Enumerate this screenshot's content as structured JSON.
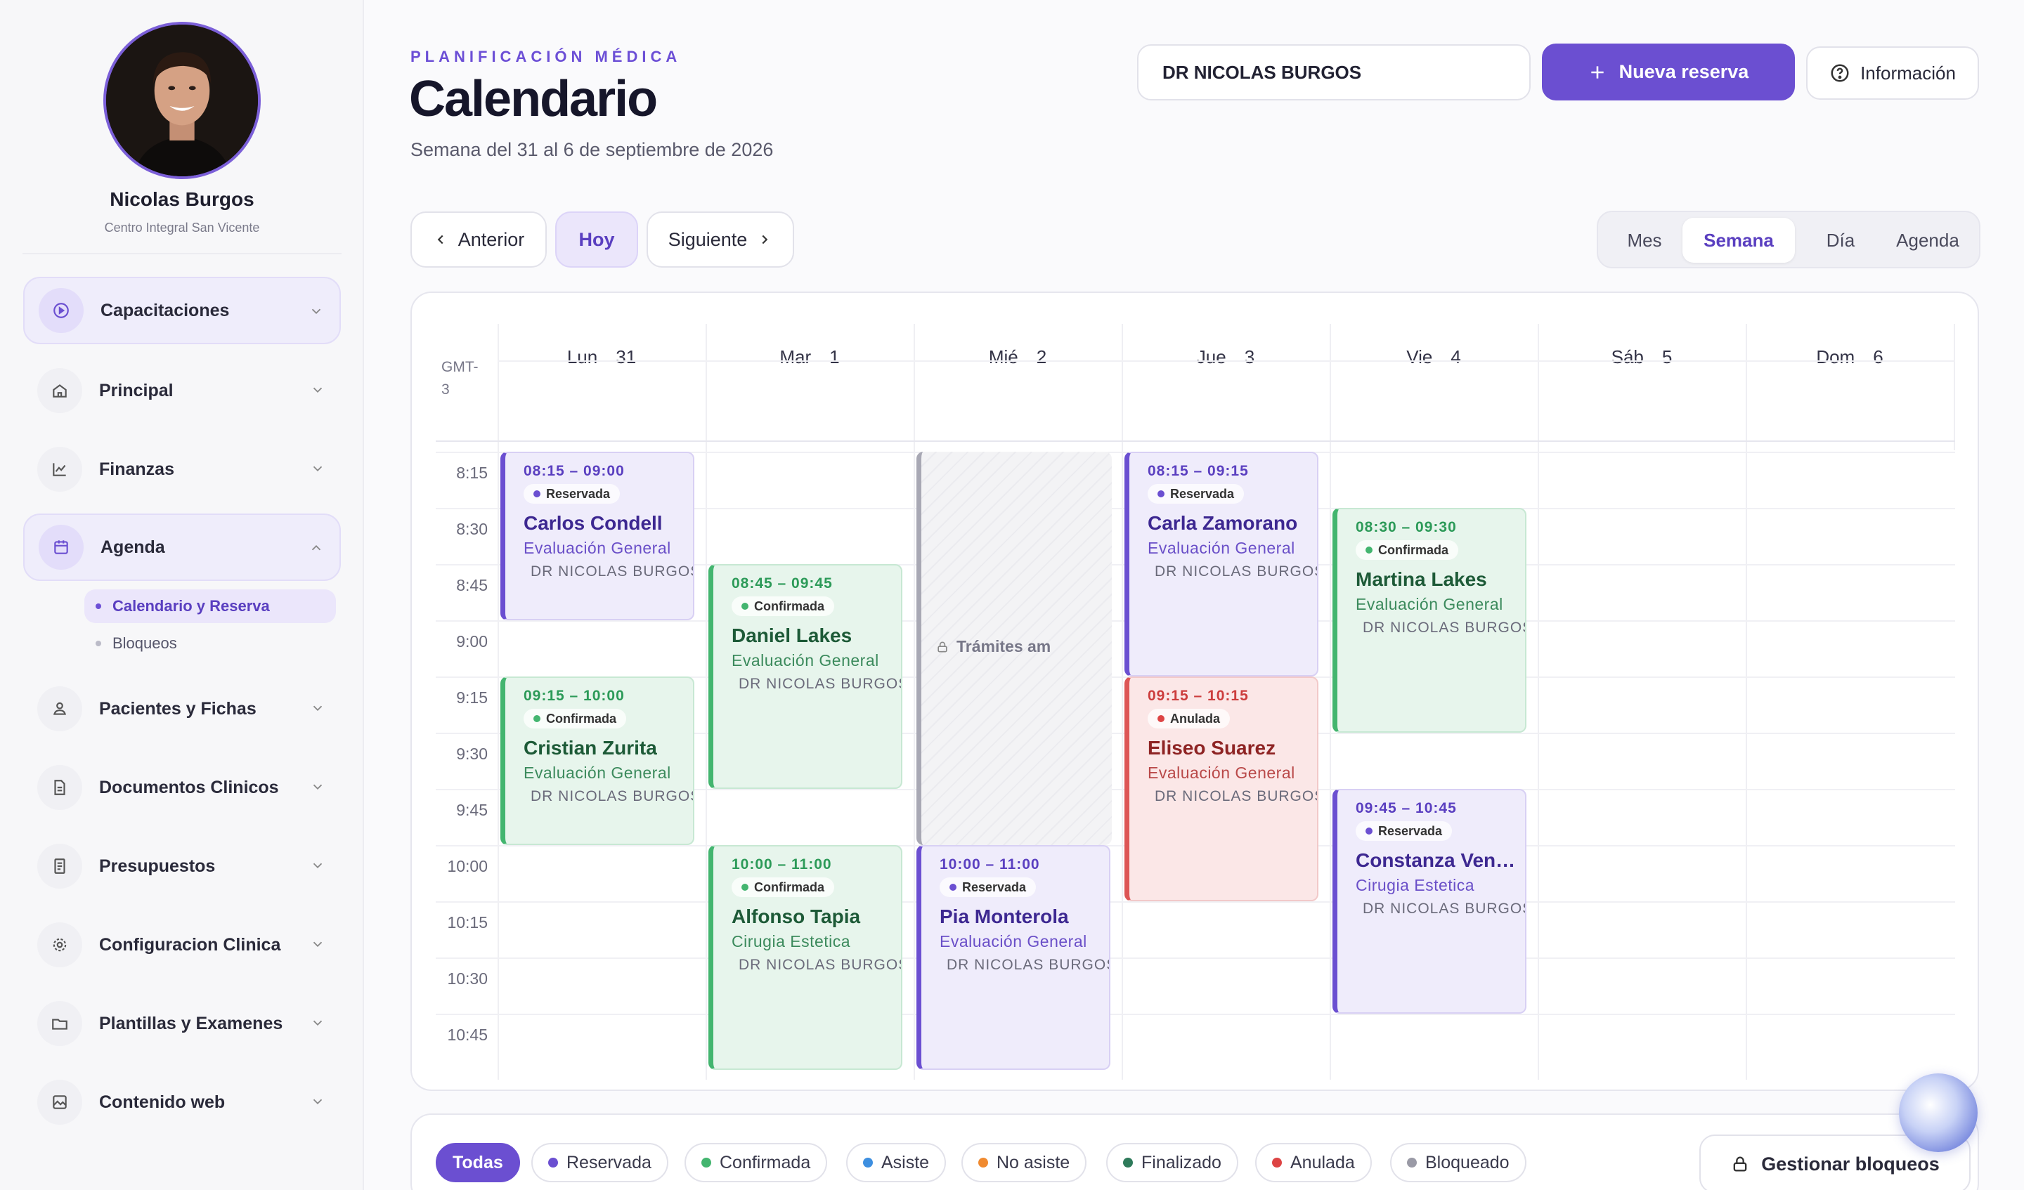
{
  "profile": {
    "name": "Nicolas Burgos",
    "clinic": "Centro Integral San Vicente"
  },
  "sidebar": {
    "items": [
      {
        "label": "Capacitaciones",
        "icon": "play-circle-icon"
      },
      {
        "label": "Principal",
        "icon": "home-icon"
      },
      {
        "label": "Finanzas",
        "icon": "chart-line-icon"
      },
      {
        "label": "Agenda",
        "icon": "calendar-icon"
      },
      {
        "label": "Pacientes y Fichas",
        "icon": "users-icon"
      },
      {
        "label": "Documentos Clinicos",
        "icon": "document-icon"
      },
      {
        "label": "Presupuestos",
        "icon": "receipt-icon"
      },
      {
        "label": "Configuracion Clinica",
        "icon": "gear-icon"
      },
      {
        "label": "Plantillas y Examenes",
        "icon": "folder-icon"
      },
      {
        "label": "Contenido web",
        "icon": "image-icon"
      }
    ],
    "agenda_sub": [
      "Calendario y Reserva",
      "Bloqueos"
    ]
  },
  "header": {
    "eyebrow": "PLANIFICACIÓN MÉDICA",
    "title": "Calendario",
    "week": "Semana del 31 al 6 de septiembre de 2026",
    "doctor": "DR NICOLAS BURGOS",
    "new_label": "Nueva reserva",
    "info_label": "Información"
  },
  "nav": {
    "prev": "Anterior",
    "today": "Hoy",
    "next": "Siguiente"
  },
  "views": [
    "Mes",
    "Semana",
    "Día",
    "Agenda"
  ],
  "calendar": {
    "timezone": "GMT-3",
    "days": [
      {
        "d": "Lun",
        "n": "31"
      },
      {
        "d": "Mar",
        "n": "1"
      },
      {
        "d": "Mié",
        "n": "2"
      },
      {
        "d": "Jue",
        "n": "3"
      },
      {
        "d": "Vie",
        "n": "4"
      },
      {
        "d": "Sáb",
        "n": "5"
      },
      {
        "d": "Dom",
        "n": "6"
      }
    ],
    "times": [
      "8:15",
      "8:30",
      "8:45",
      "9:00",
      "9:15",
      "9:30",
      "9:45",
      "10:00",
      "10:15",
      "10:30",
      "10:45"
    ],
    "block_label": "Trámites am",
    "events": [
      {
        "time": "08:15 – 09:00",
        "status": "Reservada",
        "name": "Carlos Condell",
        "service": "Evaluación General",
        "doctor": "DR NICOLAS BURGOS"
      },
      {
        "time": "09:15 – 10:00",
        "status": "Confirmada",
        "name": "Cristian Zurita",
        "service": "Evaluación General",
        "doctor": "DR NICOLAS BURGOS"
      },
      {
        "time": "08:45 – 09:45",
        "status": "Confirmada",
        "name": "Daniel Lakes",
        "service": "Evaluación General",
        "doctor": "DR NICOLAS BURGOS"
      },
      {
        "time": "10:00 – 11:00",
        "status": "Confirmada",
        "name": "Alfonso Tapia",
        "service": "Cirugia Estetica",
        "doctor": "DR NICOLAS BURGOS"
      },
      {
        "time": "10:00 – 11:00",
        "status": "Reservada",
        "name": "Pia Monterola",
        "service": "Evaluación General",
        "doctor": "DR NICOLAS BURGOS"
      },
      {
        "time": "08:15 – 09:15",
        "status": "Reservada",
        "name": "Carla Zamorano",
        "service": "Evaluación General",
        "doctor": "DR NICOLAS BURGOS"
      },
      {
        "time": "09:15 – 10:15",
        "status": "Anulada",
        "name": "Eliseo Suarez",
        "service": "Evaluación General",
        "doctor": "DR NICOLAS BURGOS"
      },
      {
        "time": "08:30 – 09:30",
        "status": "Confirmada",
        "name": "Martina Lakes",
        "service": "Evaluación General",
        "doctor": "DR NICOLAS BURGOS"
      },
      {
        "time": "09:45 – 10:45",
        "status": "Reservada",
        "name": "Constanza Venegas",
        "service": "Cirugia Estetica",
        "doctor": "DR NICOLAS BURGOS"
      }
    ]
  },
  "legend": [
    {
      "label": "Todas",
      "color": ""
    },
    {
      "label": "Reservada",
      "color": "#6b4fd1"
    },
    {
      "label": "Confirmada",
      "color": "#43b56f"
    },
    {
      "label": "Asiste",
      "color": "#3d8fe0"
    },
    {
      "label": "No asiste",
      "color": "#f08a30"
    },
    {
      "label": "Finalizado",
      "color": "#2e7a5a"
    },
    {
      "label": "Anulada",
      "color": "#dd4444"
    },
    {
      "label": "Bloqueado",
      "color": "#9a9aa6"
    }
  ],
  "manage_blocks": "Gestionar bloqueos"
}
